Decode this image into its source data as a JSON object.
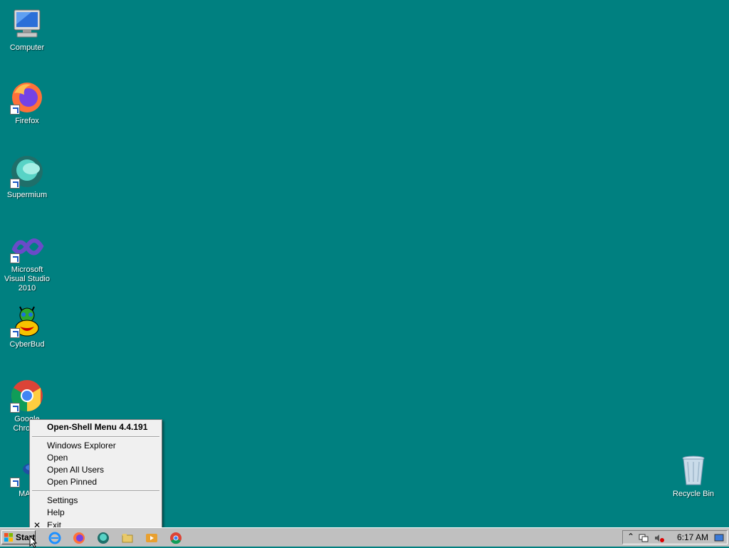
{
  "desktop": {
    "background_color": "#008080",
    "icons": [
      {
        "label": "Computer",
        "icon": "computer-icon"
      },
      {
        "label": "Firefox",
        "icon": "firefox-icon"
      },
      {
        "label": "Supermium",
        "icon": "supermium-icon"
      },
      {
        "label": "Microsoft Visual Studio 2010",
        "icon": "visual-studio-icon"
      },
      {
        "label": "CyberBud",
        "icon": "cyberbud-icon"
      },
      {
        "label": "Google Chrome",
        "icon": "chrome-icon"
      },
      {
        "label": "MAS",
        "icon": "mas-icon"
      },
      {
        "label": "Recycle Bin",
        "icon": "recycle-bin-icon"
      }
    ]
  },
  "context_menu": {
    "title": "Open-Shell Menu 4.4.191",
    "group1": [
      "Windows Explorer",
      "Open",
      "Open All Users",
      "Open Pinned"
    ],
    "group2": [
      "Settings",
      "Help",
      "Exit"
    ],
    "exit_check": "✕"
  },
  "taskbar": {
    "start_label": "Start",
    "pinned": [
      "internet-explorer-icon",
      "firefox-icon",
      "supermium-icon",
      "file-explorer-icon",
      "media-player-icon",
      "chrome-icon"
    ],
    "tray_expand": "⌃",
    "clock": "6:17 AM"
  }
}
